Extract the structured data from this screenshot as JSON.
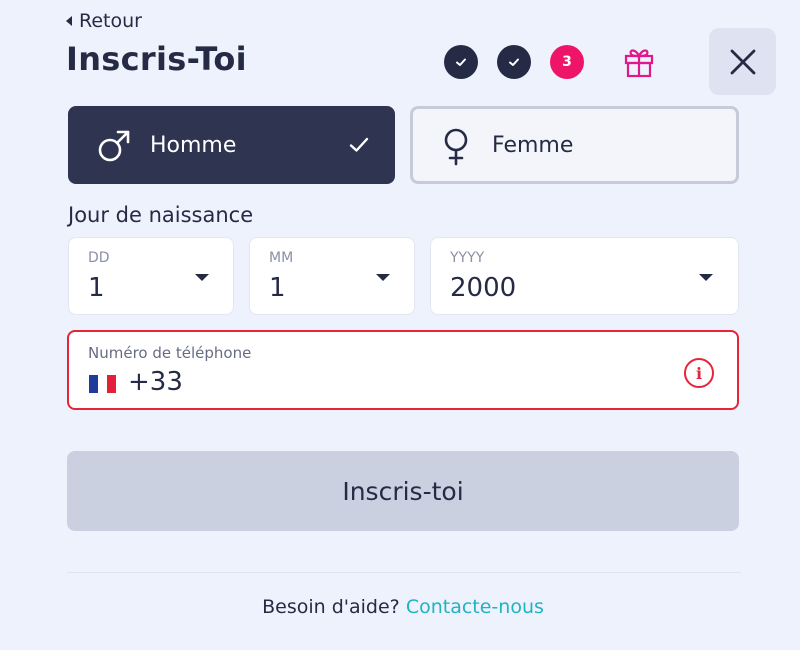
{
  "header": {
    "back_label": "Retour",
    "title": "Inscris-Toi",
    "current_step": "3"
  },
  "gender": {
    "male_label": "Homme",
    "female_label": "Femme",
    "selected": "Homme"
  },
  "dob": {
    "label": "Jour de naissance",
    "day": {
      "label": "DD",
      "value": "1"
    },
    "month": {
      "label": "MM",
      "value": "1"
    },
    "year": {
      "label": "YYYY",
      "value": "2000"
    }
  },
  "phone": {
    "label": "Numéro de téléphone",
    "value": "+33",
    "flag_colors": [
      "#1f3c9b",
      "#ffffff",
      "#e3203a"
    ]
  },
  "submit_label": "Inscris-toi",
  "help": {
    "text": "Besoin d'aide?",
    "link": "Contacte-nous"
  },
  "colors": {
    "primary_dark": "#2f3450",
    "accent_pink": "#ee1569",
    "error_red": "#e6243a",
    "link_teal": "#1fb3c4"
  },
  "icons": [
    "back-arrow-icon",
    "check-icon",
    "gift-icon",
    "close-icon",
    "male-icon",
    "female-icon",
    "chevron-down-icon",
    "info-icon",
    "flag-fr-icon"
  ]
}
